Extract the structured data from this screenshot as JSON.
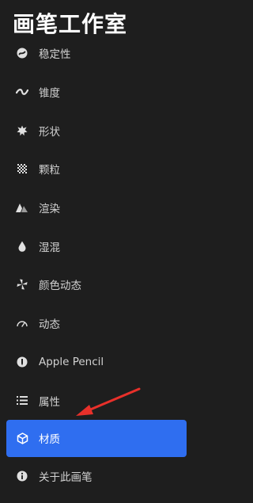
{
  "header": {
    "title": "画笔工作室"
  },
  "menu": {
    "items": [
      {
        "label": "稳定性",
        "icon": "stabilization-icon"
      },
      {
        "label": "锥度",
        "icon": "taper-wave-icon"
      },
      {
        "label": "形状",
        "icon": "shape-burst-icon"
      },
      {
        "label": "颗粒",
        "icon": "grain-pattern-icon"
      },
      {
        "label": "渲染",
        "icon": "rendering-icon"
      },
      {
        "label": "湿混",
        "icon": "wet-mix-drop-icon"
      },
      {
        "label": "颜色动态",
        "icon": "color-dynamics-icon"
      },
      {
        "label": "动态",
        "icon": "dynamics-gauge-icon"
      },
      {
        "label": "Apple Pencil",
        "icon": "apple-pencil-icon"
      },
      {
        "label": "属性",
        "icon": "properties-list-icon"
      },
      {
        "label": "材质",
        "icon": "material-cube-icon",
        "selected": true
      },
      {
        "label": "关于此画笔",
        "icon": "info-icon"
      }
    ]
  },
  "colors": {
    "background": "#1e1e1e",
    "selected": "#2f6ef0",
    "annotation_arrow": "#e8302a"
  }
}
